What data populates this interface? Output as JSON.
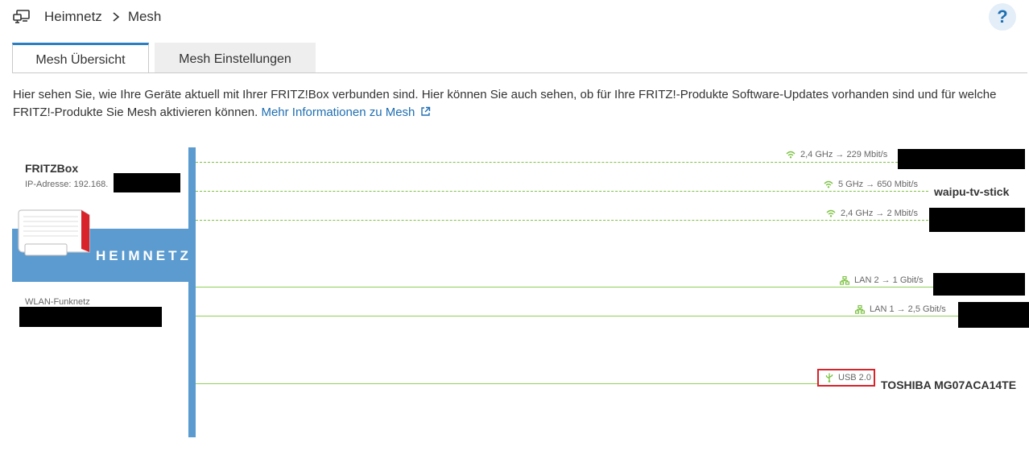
{
  "breadcrumb": {
    "root": "Heimnetz",
    "current": "Mesh"
  },
  "help": {
    "label": "?"
  },
  "tabs": [
    {
      "label": "Mesh Übersicht",
      "active": true
    },
    {
      "label": "Mesh Einstellungen",
      "active": false
    }
  ],
  "description": {
    "text": "Hier sehen Sie, wie Ihre Geräte aktuell mit Ihrer FRITZ!Box verbunden sind. Hier können Sie auch sehen, ob für Ihre FRITZ!-Produkte Software-Updates vorhanden sind und für welche FRITZ!-Produkte Sie Mesh aktivieren können.",
    "link": "Mehr Informationen zu Mesh"
  },
  "fritzbox": {
    "title": "FRITZBox",
    "ip_label": "IP-Adresse: 192.168.",
    "network_label": "HEIMNETZ",
    "wlan_label": "WLAN-Funknetz"
  },
  "connections": [
    {
      "type": "wlan",
      "label": "2,4 GHz → 229 Mbit/s",
      "device": ""
    },
    {
      "type": "wlan",
      "label": "5 GHz → 650 Mbit/s",
      "device": "waipu-tv-stick"
    },
    {
      "type": "wlan",
      "label": "2,4 GHz → 2 Mbit/s",
      "device": ""
    },
    {
      "type": "lan",
      "label": "LAN 2 → 1 Gbit/s",
      "device": ""
    },
    {
      "type": "lan",
      "label": "LAN 1 → 2,5 Gbit/s",
      "device": ""
    },
    {
      "type": "usb",
      "label": "USB 2.0",
      "device": "TOSHIBA MG07ACA14TE"
    }
  ],
  "colors": {
    "accent": "#2c7fc2",
    "panel": "#5b9bd0",
    "connection": "#7cc242",
    "highlight": "#d9232b"
  }
}
